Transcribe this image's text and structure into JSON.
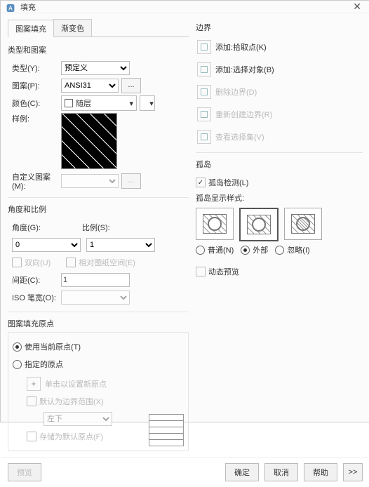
{
  "title": "填充",
  "tabs": {
    "pattern": "图案填充",
    "gradient": "渐变色"
  },
  "type_patt": {
    "heading": "类型和图案",
    "type_lbl": "类型(Y):",
    "type_val": "预定义",
    "pattern_lbl": "图案(P):",
    "pattern_val": "ANSI31",
    "ellipsis": "...",
    "color_lbl": "颜色(C):",
    "color_val": "随层",
    "sample_lbl": "样例:",
    "custom_lbl": "自定义图案(M):"
  },
  "angle_scale": {
    "heading": "角度和比例",
    "angle_lbl": "角度(G):",
    "angle_val": "0",
    "scale_lbl": "比例(S):",
    "scale_val": "1",
    "biway": "双向(U)",
    "relpaper": "相对图纸空间(E)",
    "spacing_lbl": "间距(C):",
    "spacing_val": "1",
    "iso_lbl": "ISO 笔宽(O):"
  },
  "origin": {
    "heading": "图案填充原点",
    "use_current": "使用当前原点(T)",
    "specified": "指定的原点",
    "click_set": "单击以设置新原点",
    "default_bound": "默认为边界范围(X)",
    "pos_val": "左下",
    "store_default": "存储为默认原点(F)"
  },
  "boundary": {
    "heading": "边界",
    "add_pick": "添加:拾取点(K)",
    "add_sel": "添加:选择对象(B)",
    "del": "删除边界(D)",
    "recreate": "重新创建边界(R)",
    "view_sel": "查看选择集(V)"
  },
  "island": {
    "heading": "孤岛",
    "detect": "孤岛检测(L)",
    "style_lbl": "孤岛显示样式:",
    "normal": "普通(N)",
    "outer": "外部",
    "ignore": "忽略(I)"
  },
  "dyn_preview": "动态预览",
  "footer": {
    "preview": "预览",
    "ok": "确定",
    "cancel": "取消",
    "help": "帮助",
    "expand": ">>"
  }
}
